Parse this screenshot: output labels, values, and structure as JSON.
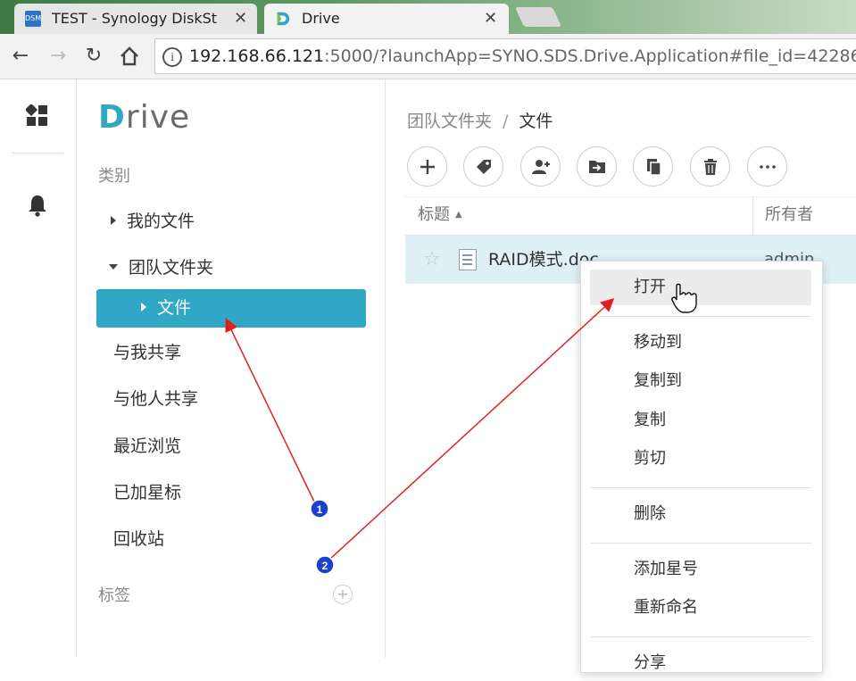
{
  "browser": {
    "tabs": [
      {
        "label": "TEST - Synology DiskSt",
        "icon": "dsm-icon",
        "icon_text": "DSM",
        "active": false
      },
      {
        "label": "Drive",
        "icon": "drive-icon",
        "active": true
      }
    ],
    "url_host": "192.168.66.121",
    "url_rest": ":5000/?launchApp=SYNO.SDS.Drive.Application#file_id=42286"
  },
  "app": {
    "logo_prefix": "D",
    "logo_rest": "rive",
    "category_label": "类别",
    "nav": [
      {
        "label": "我的文件"
      },
      {
        "label": "团队文件夹"
      },
      {
        "label": "文件"
      },
      {
        "label": "与我共享"
      },
      {
        "label": "与他人共享"
      },
      {
        "label": "最近浏览"
      },
      {
        "label": "已加星标"
      },
      {
        "label": "回收站"
      }
    ],
    "tags_label": "标签"
  },
  "breadcrumb": {
    "parent": "团队文件夹",
    "separator": "/",
    "current": "文件"
  },
  "table": {
    "columns": [
      "标题",
      "所有者"
    ],
    "rows": [
      {
        "name": "RAID模式.doc",
        "owner": "admin"
      }
    ]
  },
  "context_menu": {
    "items": [
      "打开",
      "移动到",
      "复制到",
      "复制",
      "剪切",
      "删除",
      "添加星号",
      "重新命名",
      "分享"
    ],
    "hovered": "打开"
  },
  "annotations": [
    {
      "number": "1"
    },
    {
      "number": "2"
    }
  ],
  "colors": {
    "accent": "#2fa7c5",
    "arrow": "#e02020",
    "marker": "#1a3fd1"
  }
}
